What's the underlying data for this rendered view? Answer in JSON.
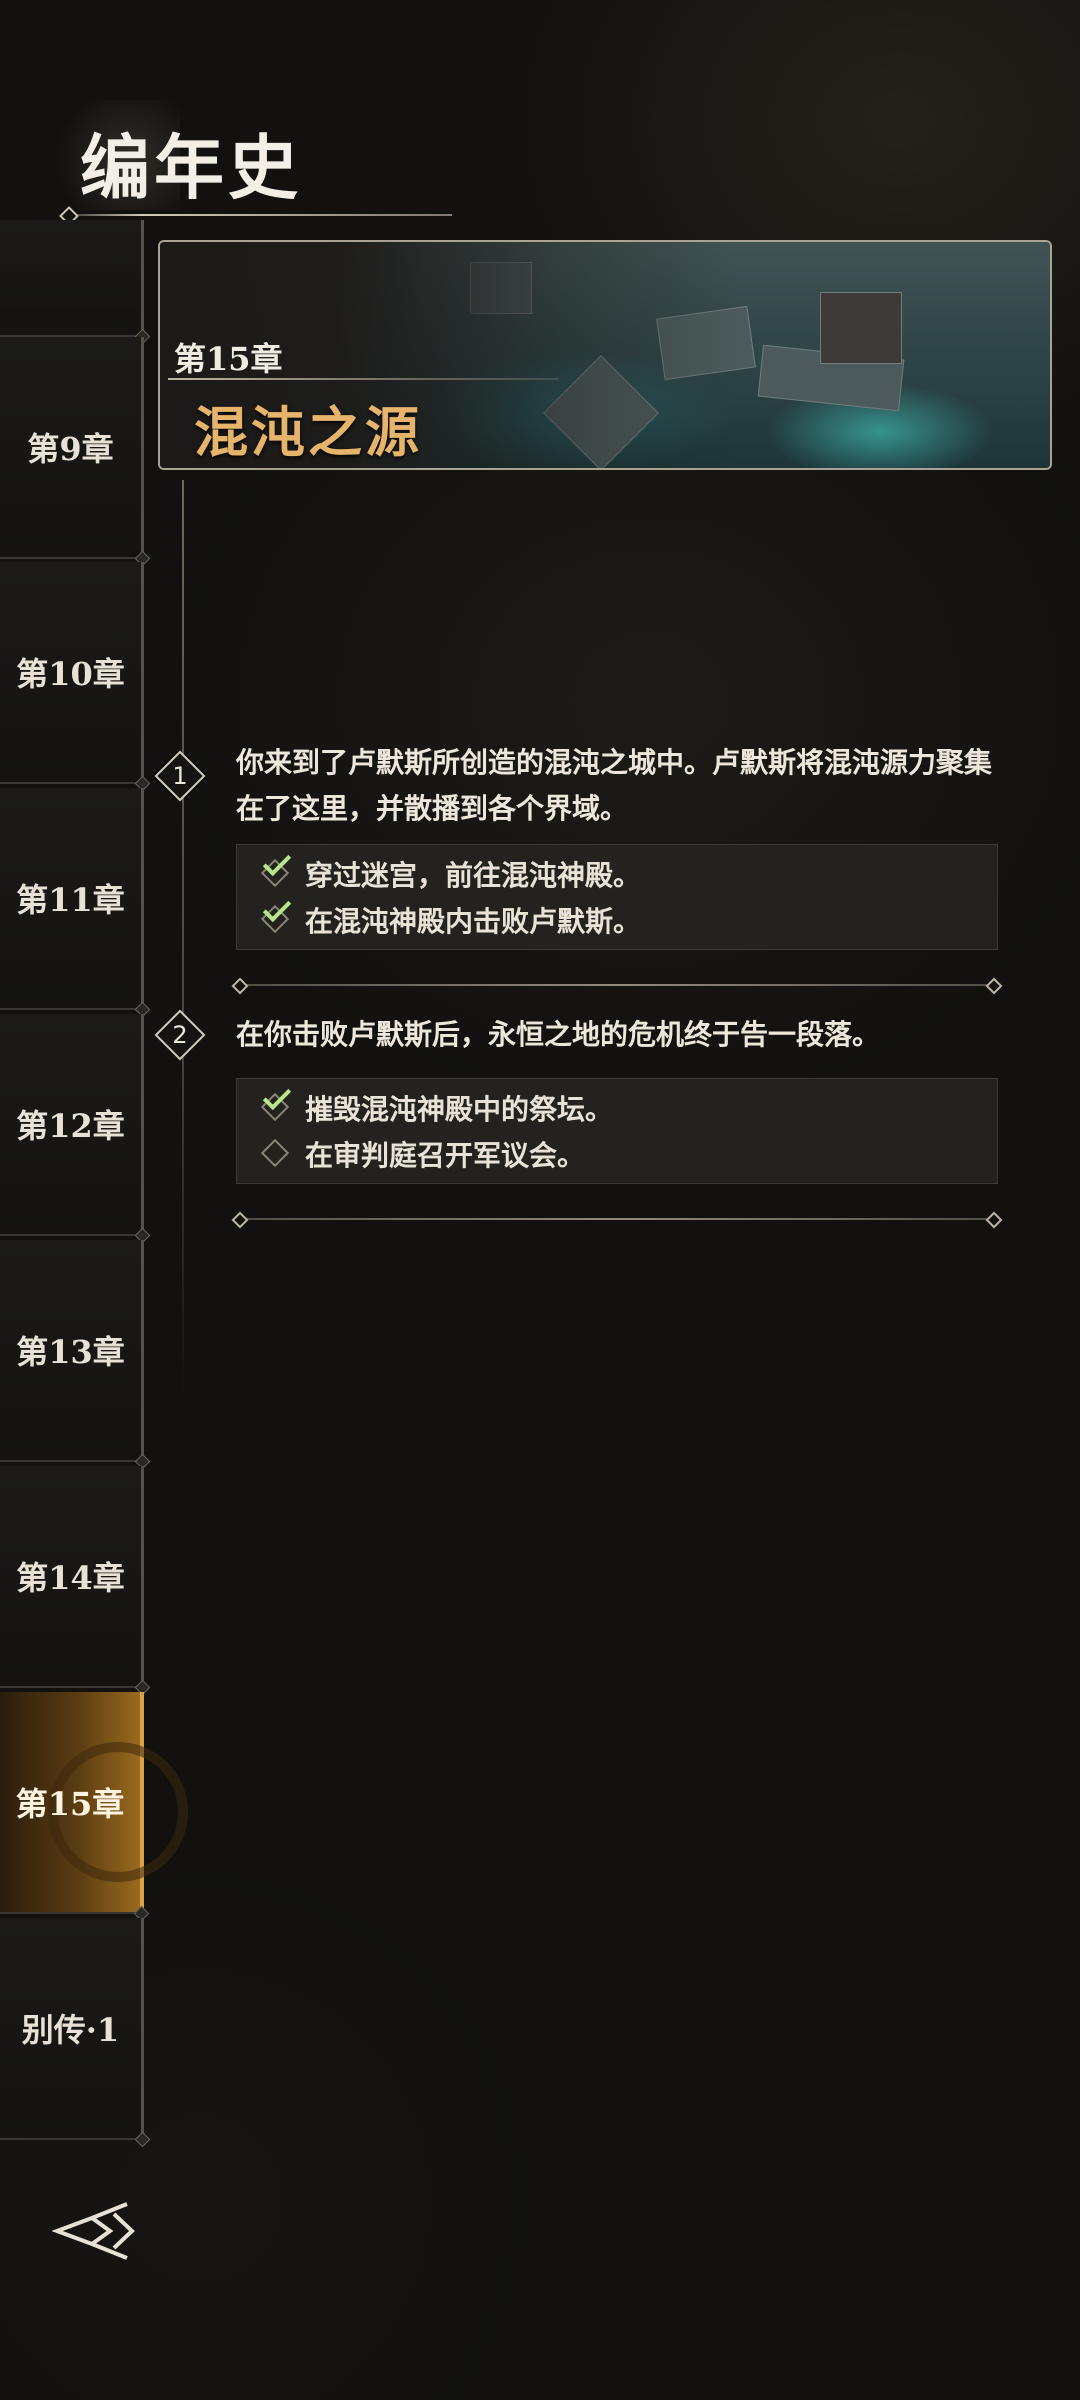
{
  "header": {
    "title": "编年史"
  },
  "sidebar": {
    "tabs": [
      {
        "label": ""
      },
      {
        "label": "第9章"
      },
      {
        "label": "第10章"
      },
      {
        "label": "第11章"
      },
      {
        "label": "第12章"
      },
      {
        "label": "第13章"
      },
      {
        "label": "第14章"
      },
      {
        "label": "第15章"
      },
      {
        "label": "别传·1"
      }
    ],
    "active_tab": "第15章"
  },
  "chapter": {
    "number": "第15章",
    "title": "混沌之源",
    "steps": [
      {
        "index": "1",
        "text": "你来到了卢默斯所创造的混沌之城中。卢默斯将混沌源力聚集在了这里，并散播到各个界域。",
        "tasks": [
          {
            "text": "穿过迷宫，前往混沌神殿。",
            "done": true
          },
          {
            "text": "在混沌神殿内击败卢默斯。",
            "done": true
          }
        ]
      },
      {
        "index": "2",
        "text": "在你击败卢默斯后，永恒之地的危机终于告一段落。",
        "tasks": [
          {
            "text": "摧毁混沌神殿中的祭坛。",
            "done": true
          },
          {
            "text": "在审判庭召开军议会。",
            "done": false
          }
        ]
      }
    ]
  },
  "colors": {
    "accent_gold": "#e6b46a",
    "check_green": "#b8e68a",
    "active_tab": "#9a6a1e"
  },
  "icons": {
    "back": "back-arrow-icon",
    "check": "check-icon",
    "unchecked": "empty-diamond-icon"
  }
}
